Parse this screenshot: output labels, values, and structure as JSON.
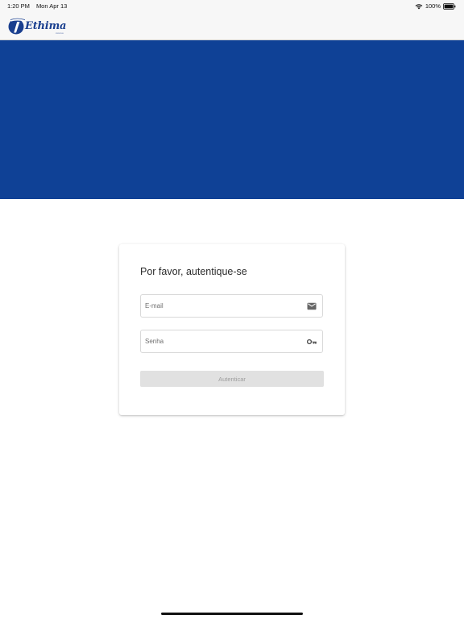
{
  "status_bar": {
    "time": "1:20 PM",
    "date": "Mon Apr 13",
    "battery_percent": "100%",
    "battery_level": 1.0,
    "icons": [
      "wifi-icon",
      "battery-icon"
    ]
  },
  "header": {
    "logo_text": "Ethima",
    "logo_sub": "sistemas"
  },
  "colors": {
    "brand_blue": "#0f4196",
    "button_disabled_bg": "#e1e1e1",
    "button_disabled_text": "#9d9d9d"
  },
  "login": {
    "title": "Por favor, autentique-se",
    "email": {
      "placeholder": "E-mail",
      "value": "",
      "icon": "mail-icon"
    },
    "password": {
      "placeholder": "Senha",
      "value": "",
      "icon": "key-icon"
    },
    "submit_label": "Autenticar",
    "submit_enabled": false
  }
}
